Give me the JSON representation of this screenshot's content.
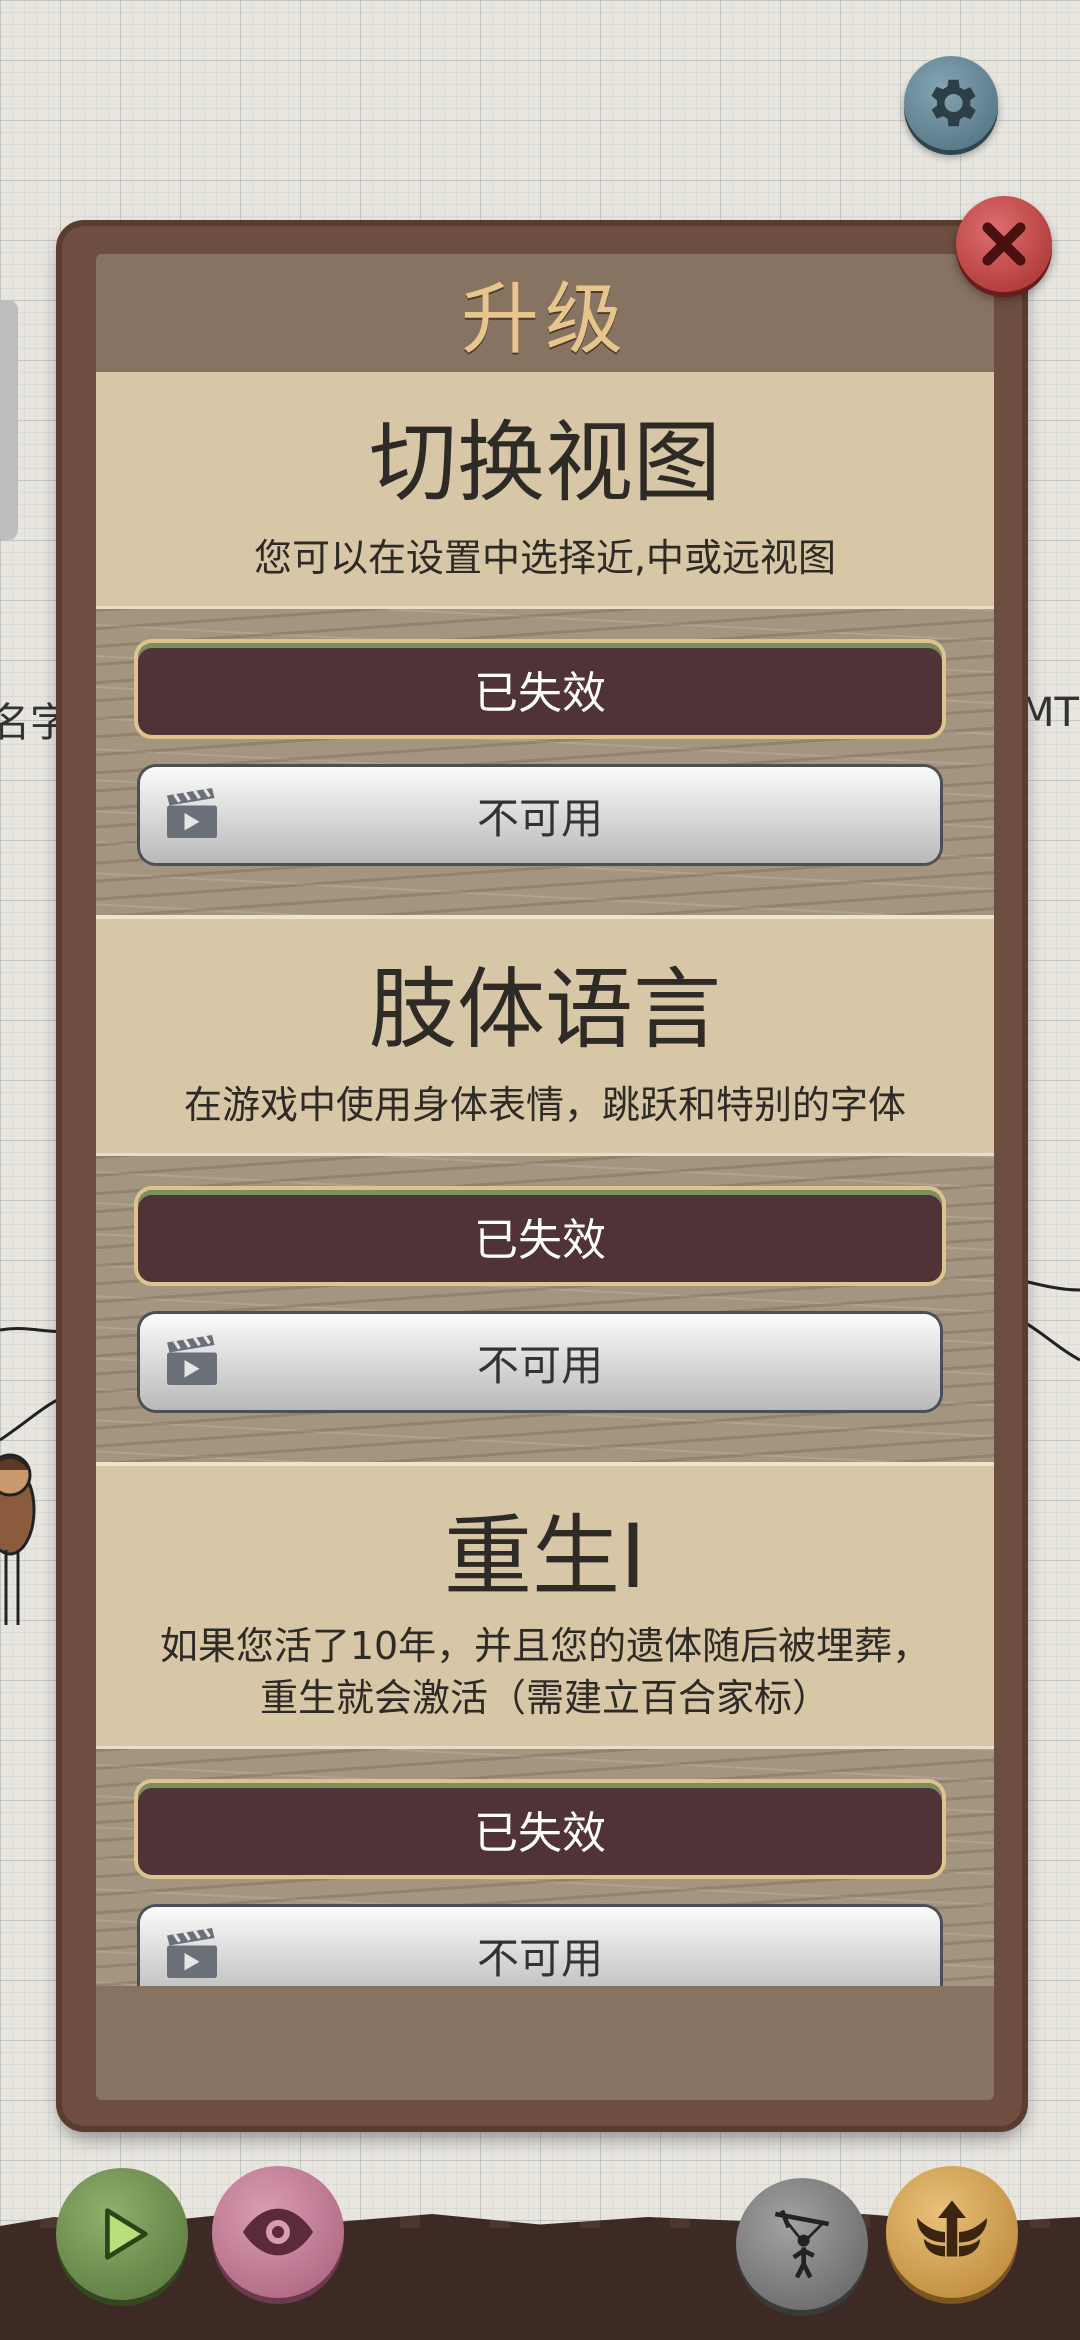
{
  "background": {
    "left_text": "名字",
    "right_text": "MT"
  },
  "dialog": {
    "title": "升级",
    "cards": [
      {
        "title": "切换视图",
        "desc": [
          "您可以在设置中选择近,中或远视图"
        ],
        "status_label": "已失效",
        "action_label": "不可用"
      },
      {
        "title": "肢体语言",
        "desc": [
          "在游戏中使用身体表情，跳跃和特别的字体"
        ],
        "status_label": "已失效",
        "action_label": "不可用"
      },
      {
        "title": "重生I",
        "desc": [
          "如果您活了10年，并且您的遗体随后被埋葬，",
          "重生就会激活（需建立百合家标）"
        ],
        "status_label": "已失效",
        "action_label": "不可用"
      }
    ]
  },
  "icons": {
    "settings": "gear-icon",
    "close": "close-icon",
    "play": "play-icon",
    "view": "eye-icon",
    "puppet": "puppet-icon",
    "upgrade": "winged-arrow-icon",
    "video": "clapperboard-icon"
  },
  "colors": {
    "title": "#e7c68e",
    "disabled_button": "#4f3336",
    "close": "#b93b3b",
    "play": "#6a8b4a",
    "view": "#b96f8c",
    "upgrade": "#cf9a45"
  }
}
